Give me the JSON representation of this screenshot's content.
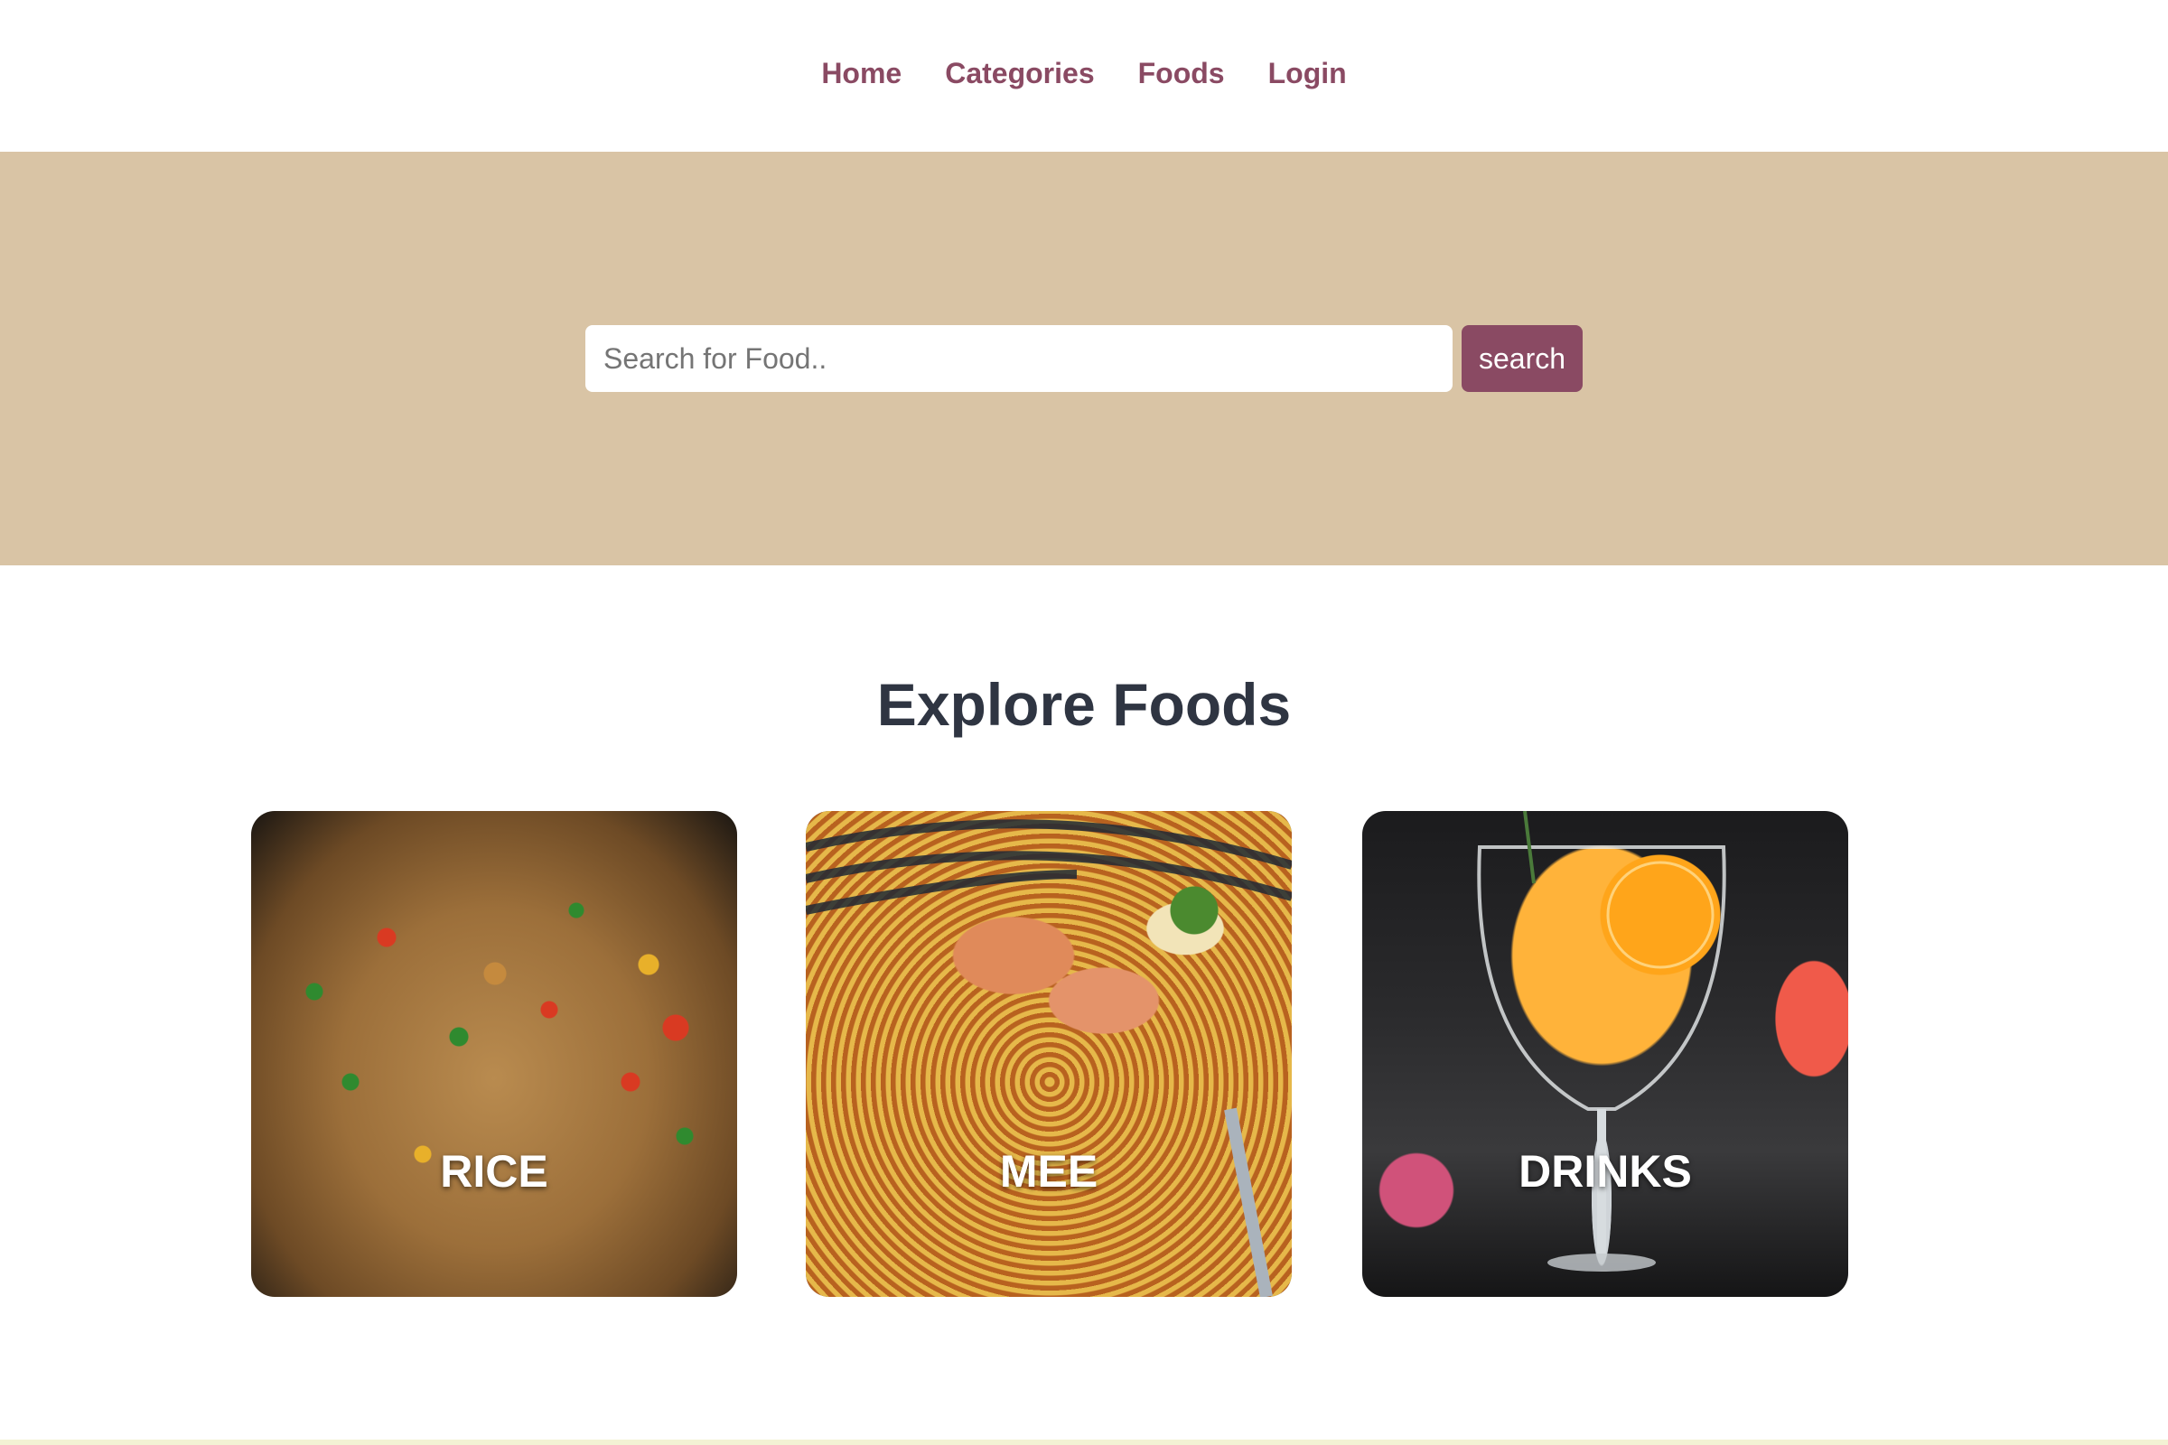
{
  "nav": {
    "items": [
      {
        "label": "Home"
      },
      {
        "label": "Categories"
      },
      {
        "label": "Foods"
      },
      {
        "label": "Login"
      }
    ]
  },
  "hero": {
    "search_placeholder": "Search for Food..",
    "search_button_label": "search"
  },
  "explore": {
    "title": "Explore Foods",
    "categories": [
      {
        "label": "RICE"
      },
      {
        "label": "MEE"
      },
      {
        "label": "DRINKS"
      }
    ]
  },
  "colors": {
    "accent": "#8a4a63",
    "hero_bg": "#d9c4a5",
    "title_text": "#2f3542"
  }
}
